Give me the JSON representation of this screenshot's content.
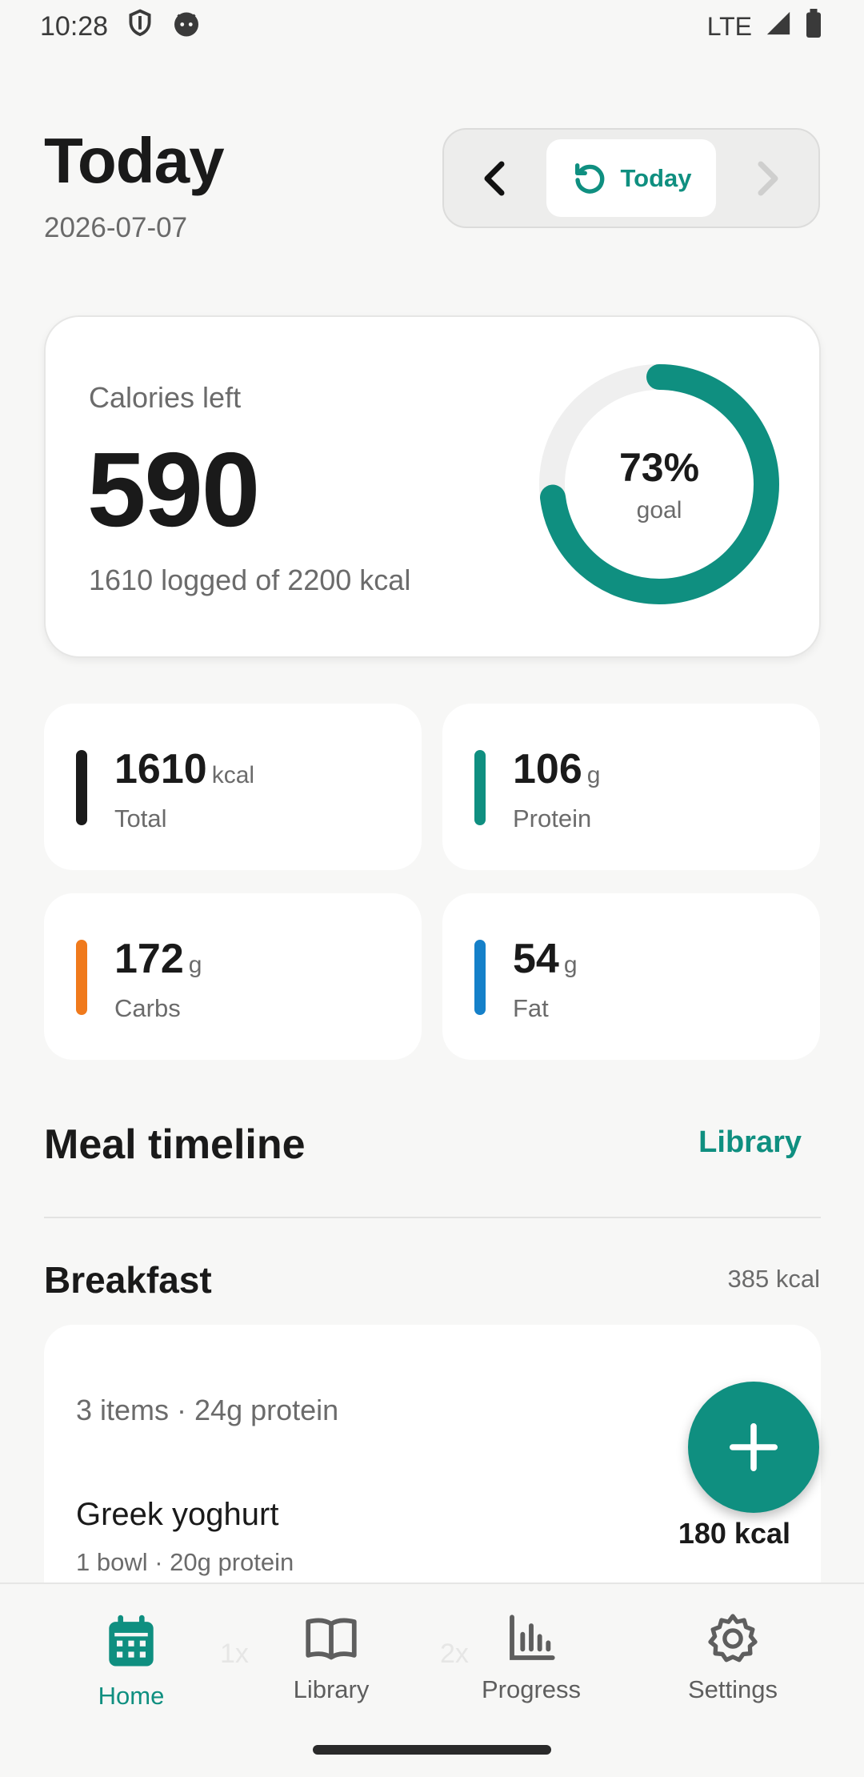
{
  "status": {
    "time": "10:28",
    "network": "LTE"
  },
  "header": {
    "title": "Today",
    "date": "2026-07-07"
  },
  "date_switch": {
    "today_label": "Today"
  },
  "calorie_card": {
    "label": "Calories left",
    "value": "590",
    "subtitle": "1610 logged of 2200 kcal",
    "percent_text": "73%",
    "goal_label": "goal",
    "progress": 0.73,
    "ring_color": "#0f8f80",
    "ring_track_color": "#efefef"
  },
  "stats": [
    {
      "value": "1610",
      "unit": "kcal",
      "label": "Total",
      "color": "#1a1a1a"
    },
    {
      "value": "106",
      "unit": "g",
      "label": "Protein",
      "color": "#0f8f80"
    },
    {
      "value": "172",
      "unit": "g",
      "label": "Carbs",
      "color": "#f07a1c"
    },
    {
      "value": "54",
      "unit": "g",
      "label": "Fat",
      "color": "#1580c9"
    }
  ],
  "timeline": {
    "title": "Meal timeline",
    "library_link": "Library"
  },
  "breakfast": {
    "title": "Breakfast",
    "kcal": "385 kcal",
    "summary": "3 items · 24g protein",
    "item": {
      "name": "Greek yoghurt",
      "detail": "1 bowl · 20g protein",
      "kcal": "180 kcal"
    }
  },
  "nav": {
    "home": "Home",
    "library": "Library",
    "progress": "Progress",
    "settings": "Settings",
    "ghost_1": "1x",
    "ghost_2": "2x"
  },
  "colors": {
    "accent": "#0f8f80",
    "background": "#f7f7f6"
  }
}
